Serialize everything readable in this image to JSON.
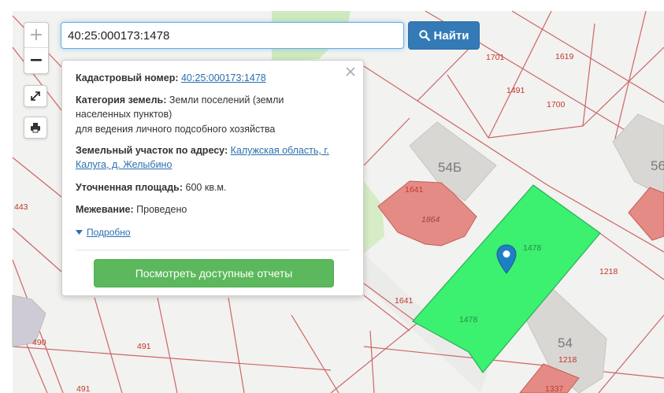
{
  "search": {
    "value": "40:25:000173:1478",
    "button_label": "Найти"
  },
  "controls": {
    "zoom_in": "+",
    "zoom_out": "−"
  },
  "popup": {
    "cadastral_label": "Кадастровый номер:",
    "cadastral_value": "40:25:000173:1478",
    "category_label": "Категория земель:",
    "category_value_1": "Земли поселений (земли населенных пунктов)",
    "category_value_2": "для ведения личного подсобного хозяйства",
    "address_label": "Земельный участок по адресу:",
    "address_value": "Калужская область, г. Калуга, д. Желыбино",
    "area_label": "Уточненная площадь:",
    "area_value": "600 кв.м.",
    "survey_label": "Межевание:",
    "survey_value": "Проведено",
    "more_link": "Подробно",
    "reports_button": "Посмотреть доступные отчеты"
  },
  "map": {
    "parcel_labels": {
      "p1701": "1701",
      "p1619": "1619",
      "p1491": "1491",
      "p1700": "1700",
      "p443": "443",
      "p1641a": "1641",
      "p1864": "1864",
      "p1478a": "1478",
      "p1218a": "1218",
      "p1641b": "1641",
      "p1478b": "1478",
      "p490": "490",
      "p491a": "491",
      "p491b": "491",
      "p1218b": "1218",
      "p1337": "1337"
    },
    "building_labels": {
      "b54b": "54Б",
      "b56": "56",
      "b54": "54"
    },
    "colors": {
      "selected_parcel": "#3cf070",
      "parcel_border": "#c0392b",
      "building_gray": "#d8d6d3",
      "building_pink": "#e38a86",
      "marker": "#1f7fc4"
    }
  }
}
